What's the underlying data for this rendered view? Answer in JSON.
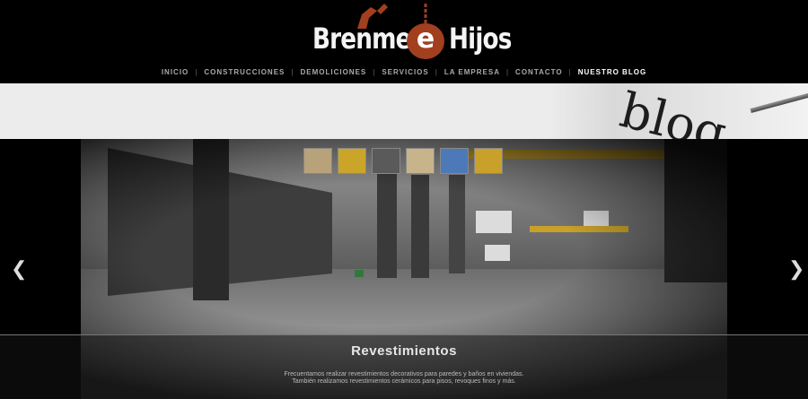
{
  "brand": {
    "name_part1": "Brenme",
    "name_connector": "e",
    "name_part2": "Hijos"
  },
  "nav": {
    "items": [
      "INICIO",
      "CONSTRUCCIONES",
      "DEMOLICIONES",
      "SERVICIOS",
      "LA EMPRESA",
      "CONTACTO",
      "NUESTRO BLOG"
    ],
    "active": "NUESTRO BLOG"
  },
  "banner": {
    "word": "blog"
  },
  "slider": {
    "thumbnails": [
      "thumb-1",
      "thumb-2",
      "thumb-3",
      "thumb-4",
      "thumb-5",
      "thumb-6"
    ],
    "prev_icon": "chevron-left-icon",
    "next_icon": "chevron-right-icon",
    "caption_title": "Revestimientos",
    "caption_line1": "Frecuentamos realizar revestimientos decorativos para paredes y baños en viviendas.",
    "caption_line2": "También realizamos revestimientos cerámicos para pisos, revoques finos y más."
  },
  "colors": {
    "brand_accent": "#a23f1e",
    "background": "#000000"
  }
}
